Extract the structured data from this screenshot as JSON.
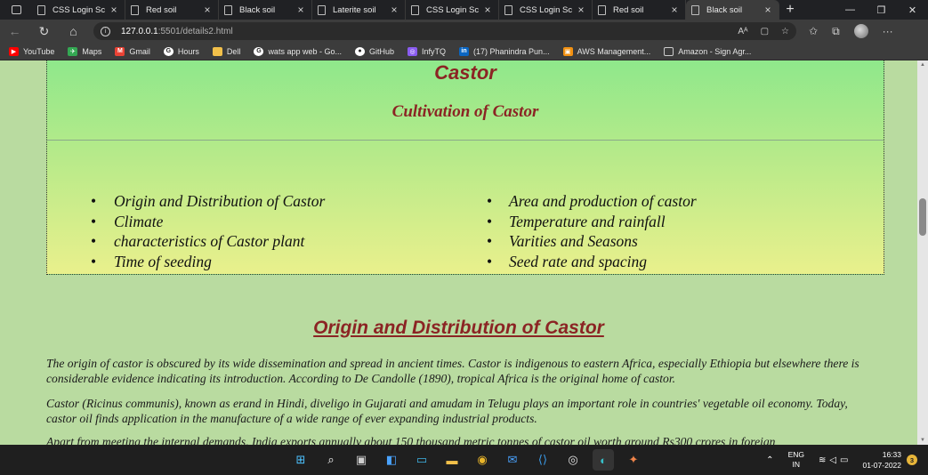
{
  "browser": {
    "tabs": [
      {
        "label": "CSS Login Sc",
        "active": false
      },
      {
        "label": "Red soil",
        "active": false
      },
      {
        "label": "Black soil",
        "active": false
      },
      {
        "label": "Laterite soil",
        "active": false
      },
      {
        "label": "CSS Login Sc",
        "active": false
      },
      {
        "label": "CSS Login Sc",
        "active": false
      },
      {
        "label": "Red soil",
        "active": false
      },
      {
        "label": "Black soil",
        "active": true
      }
    ],
    "new_tab": "+",
    "address": {
      "host": "127.0.0.1",
      "path": ":5501/details2.html"
    },
    "bookmarks": [
      {
        "label": "YouTube",
        "icon": "youtube-icon",
        "color": "#ff0000"
      },
      {
        "label": "Maps",
        "icon": "maps-icon",
        "color": "#34a853"
      },
      {
        "label": "Gmail",
        "icon": "gmail-icon",
        "color": "#ea4335"
      },
      {
        "label": "Hours",
        "icon": "google-icon",
        "color": "#ffffff"
      },
      {
        "label": "Dell",
        "icon": "folder-icon",
        "color": "#f2c04a"
      },
      {
        "label": "wats app web - Go...",
        "icon": "google-icon",
        "color": "#ffffff"
      },
      {
        "label": "GitHub",
        "icon": "github-icon",
        "color": "#ffffff"
      },
      {
        "label": "InfyTQ",
        "icon": "infytq-icon",
        "color": "#8a5cf0"
      },
      {
        "label": "(17) Phanindra Pun...",
        "icon": "linkedin-icon",
        "color": "#0a66c2"
      },
      {
        "label": "AWS Management...",
        "icon": "aws-icon",
        "color": "#f29111"
      },
      {
        "label": "Amazon - Sign Agr...",
        "icon": "page-icon",
        "color": "#cccccc"
      }
    ]
  },
  "page": {
    "title": "Castor",
    "subtitle": "Cultivation of Castor",
    "toc_left": [
      "Origin and Distribution of Castor",
      "Climate",
      "characteristics of Castor plant",
      "Time of seeding"
    ],
    "toc_right": [
      "Area and production of castor",
      "Temperature and rainfall",
      "Varities and Seasons",
      "Seed rate and spacing"
    ],
    "section_title": "Origin and Distribution of Castor",
    "paragraphs": [
      "The origin of castor is obscured by its wide dissemination and spread in ancient times. Castor is indigenous to eastern Africa, especially Ethiopia but elsewhere there is considerable evidence indicating its introduction. According to De Candolle (1890), tropical Africa is the original home of castor.",
      "Castor (Ricinus communis), known as erand in Hindi, diveligo in Gujarati and amudam in Telugu plays an important role in countries' vegetable oil economy. Today, castor oil finds application in the manufacture of a wide range of ever expanding industrial products.",
      "Apart from meeting the internal demands, India exports annually about 150 thousand metric tonnes of castor oil worth around Rs300 crores in foreign"
    ]
  },
  "taskbar": {
    "lang": "ENG",
    "region": "IN",
    "time": "16:33",
    "date": "01-07-2022",
    "notifications": "3"
  },
  "colors": {
    "heading": "#8b2424",
    "hero_top": "#8de88b",
    "hero_bottom": "#e9f08c",
    "page_bg": "#b9dba0"
  }
}
